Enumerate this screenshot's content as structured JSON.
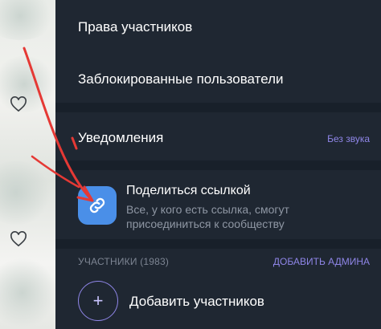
{
  "menu": {
    "member_rights": "Права участников",
    "blocked_users": "Заблокированные пользователи",
    "notifications": "Уведомления",
    "notifications_state": "Без звука"
  },
  "share": {
    "icon": "link-icon",
    "title": "Поделиться ссылкой",
    "description": "Все, у кого есть ссылка, смогут присоединиться к сообществу"
  },
  "members": {
    "section_label": "УЧАСТНИКИ (1983)",
    "add_admin": "ДОБАВИТЬ АДМИНА",
    "add_members_icon": "plus-icon",
    "add_members": "Добавить участников"
  },
  "colors": {
    "panel_bg": "#1f2732",
    "accent": "#8f86e8",
    "share_icon_bg": "#4a8fe8",
    "annotation_arrow": "#e53935"
  }
}
